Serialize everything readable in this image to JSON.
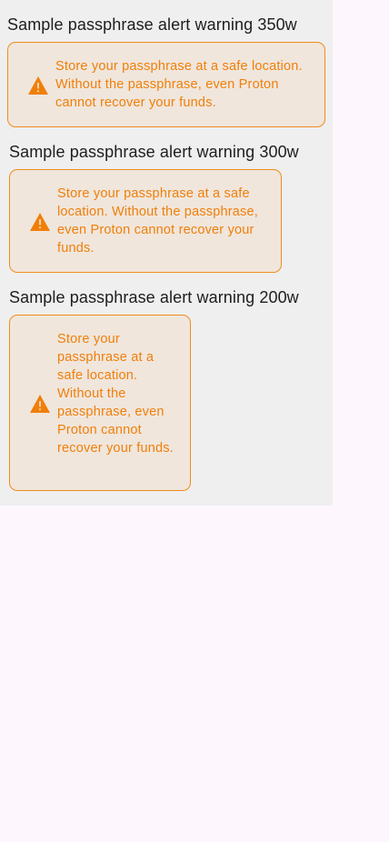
{
  "colors": {
    "alert_text": "#f07f0a",
    "alert_border": "#f08c1c",
    "alert_background": "#f0e6dc",
    "panel_background": "#efefef",
    "page_background": "#fdf7fd",
    "title_text": "#1e1e1e"
  },
  "samples": [
    {
      "title": "Sample passphrase alert warning 350w",
      "icon": "warning-triangle-icon",
      "message": "Store your passphrase at a safe location. Without the passphrase, even Proton cannot recover your funds."
    },
    {
      "title": "Sample passphrase alert warning 300w",
      "icon": "warning-triangle-icon",
      "message": "Store your passphrase at a safe location. Without the passphrase, even Proton cannot recover your funds."
    },
    {
      "title": "Sample passphrase alert warning 200w",
      "icon": "warning-triangle-icon",
      "message": "Store your passphrase at a safe location. Without the passphrase, even Proton cannot recover your funds."
    }
  ]
}
